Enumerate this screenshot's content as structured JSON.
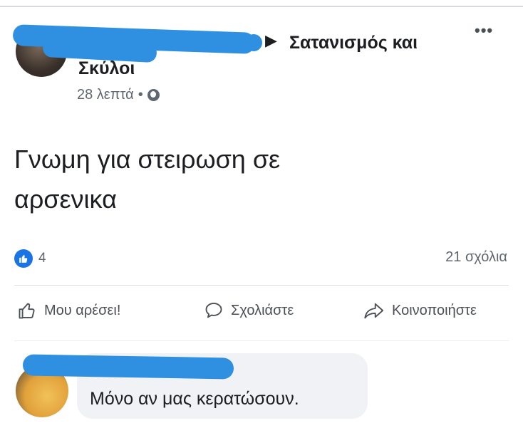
{
  "post": {
    "group_name_line1": "Σατανισμός και",
    "group_name_line2": "Σκύλοι",
    "timestamp": "28 λεπτά",
    "separator": "•",
    "text_line1": "Γνωμη για στειρωση σε",
    "text_line2": "αρσενικα",
    "like_count": "4",
    "comment_count": "21 σχόλια"
  },
  "actions": {
    "like_label": "Μου αρέσει!",
    "comment_label": "Σχολιάστε",
    "share_label": "Κοινοποιήστε"
  },
  "comment": {
    "text": "Μόνο αν μας κερατώσουν."
  },
  "colors": {
    "redaction": "#2f8fe0",
    "like_badge": "#1b74e4",
    "secondary_text": "#606770"
  },
  "icons": {
    "more": "more-horizontal-icon",
    "globe": "globe-icon",
    "like": "thumbs-up-icon",
    "comment": "comment-bubble-icon",
    "share": "share-arrow-icon"
  }
}
